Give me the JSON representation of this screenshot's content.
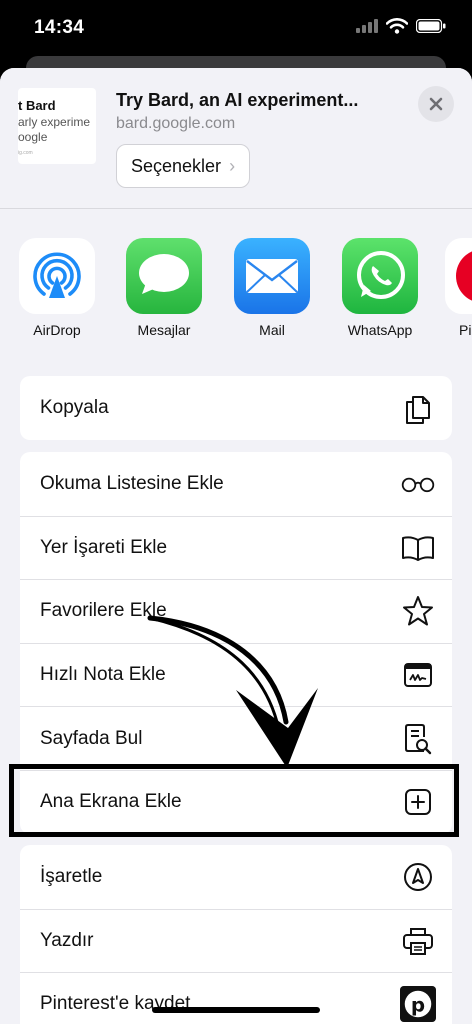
{
  "status_bar": {
    "time": "14:34"
  },
  "preview": {
    "thumb_lines": [
      "t Bard",
      "arly experime",
      "oogle",
      "ig.com"
    ],
    "title": "Try Bard, an AI experiment...",
    "url": "bard.google.com",
    "options_label": "Seçenekler"
  },
  "apps": [
    {
      "label": "AirDrop",
      "icon": "airdrop-icon"
    },
    {
      "label": "Mesajlar",
      "icon": "messages-icon"
    },
    {
      "label": "Mail",
      "icon": "mail-icon"
    },
    {
      "label": "WhatsApp",
      "icon": "whatsapp-icon"
    },
    {
      "label": "Pi",
      "icon": "pinterest-app-icon"
    }
  ],
  "actions": {
    "group1": [
      {
        "label": "Kopyala",
        "icon": "copy-icon"
      }
    ],
    "group2": [
      {
        "label": "Okuma Listesine Ekle",
        "icon": "glasses-icon"
      },
      {
        "label": "Yer İşareti Ekle",
        "icon": "book-icon"
      },
      {
        "label": "Favorilere Ekle",
        "icon": "star-icon"
      },
      {
        "label": "Hızlı Nota Ekle",
        "icon": "quick-note-icon"
      },
      {
        "label": "Sayfada Bul",
        "icon": "find-in-page-icon"
      },
      {
        "label": "Ana Ekrana Ekle",
        "icon": "add-square-icon"
      }
    ],
    "group3": [
      {
        "label": "İşaretle",
        "icon": "markup-icon"
      },
      {
        "label": "Yazdır",
        "icon": "printer-icon"
      },
      {
        "label": "Pinterest'e kaydet",
        "icon": "pinterest-icon"
      }
    ]
  },
  "colors": {
    "sheet_bg": "#f2f2f7",
    "messages_green": "#34c759",
    "mail_blue": "#1e8cf5",
    "whatsapp_green": "#29c44a",
    "airdrop_blue": "#1d8cf8",
    "highlight": "#000000"
  }
}
